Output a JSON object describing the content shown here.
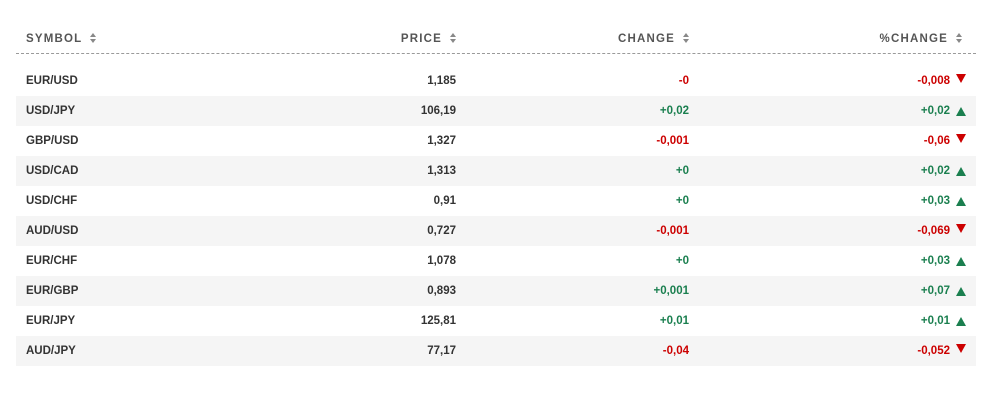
{
  "columns": {
    "symbol": "SYMBOL",
    "price": "PRICE",
    "change": "CHANGE",
    "pct_change": "%CHANGE"
  },
  "colors": {
    "positive": "#1a7f4f",
    "negative": "#cc0000"
  },
  "rows": [
    {
      "symbol": "EUR/USD",
      "price": "1,185",
      "change": "-0",
      "pct_change": "-0,008",
      "direction": "down"
    },
    {
      "symbol": "USD/JPY",
      "price": "106,19",
      "change": "+0,02",
      "pct_change": "+0,02",
      "direction": "up"
    },
    {
      "symbol": "GBP/USD",
      "price": "1,327",
      "change": "-0,001",
      "pct_change": "-0,06",
      "direction": "down"
    },
    {
      "symbol": "USD/CAD",
      "price": "1,313",
      "change": "+0",
      "pct_change": "+0,02",
      "direction": "up"
    },
    {
      "symbol": "USD/CHF",
      "price": "0,91",
      "change": "+0",
      "pct_change": "+0,03",
      "direction": "up"
    },
    {
      "symbol": "AUD/USD",
      "price": "0,727",
      "change": "-0,001",
      "pct_change": "-0,069",
      "direction": "down"
    },
    {
      "symbol": "EUR/CHF",
      "price": "1,078",
      "change": "+0",
      "pct_change": "+0,03",
      "direction": "up"
    },
    {
      "symbol": "EUR/GBP",
      "price": "0,893",
      "change": "+0,001",
      "pct_change": "+0,07",
      "direction": "up"
    },
    {
      "symbol": "EUR/JPY",
      "price": "125,81",
      "change": "+0,01",
      "pct_change": "+0,01",
      "direction": "up"
    },
    {
      "symbol": "AUD/JPY",
      "price": "77,17",
      "change": "-0,04",
      "pct_change": "-0,052",
      "direction": "down"
    }
  ]
}
